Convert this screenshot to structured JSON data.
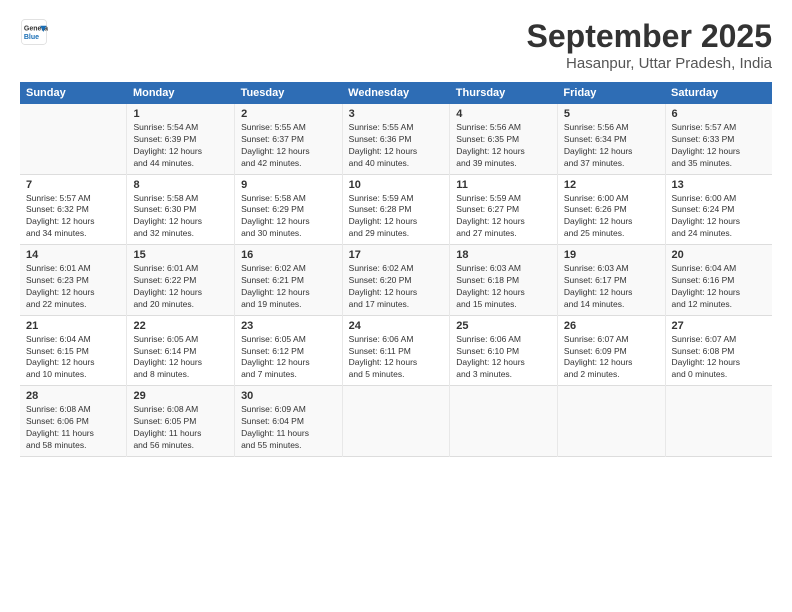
{
  "logo": {
    "line1": "General",
    "line2": "Blue"
  },
  "title": "September 2025",
  "subtitle": "Hasanpur, Uttar Pradesh, India",
  "days_header": [
    "Sunday",
    "Monday",
    "Tuesday",
    "Wednesday",
    "Thursday",
    "Friday",
    "Saturday"
  ],
  "weeks": [
    [
      {
        "num": "",
        "info": ""
      },
      {
        "num": "1",
        "info": "Sunrise: 5:54 AM\nSunset: 6:39 PM\nDaylight: 12 hours\nand 44 minutes."
      },
      {
        "num": "2",
        "info": "Sunrise: 5:55 AM\nSunset: 6:37 PM\nDaylight: 12 hours\nand 42 minutes."
      },
      {
        "num": "3",
        "info": "Sunrise: 5:55 AM\nSunset: 6:36 PM\nDaylight: 12 hours\nand 40 minutes."
      },
      {
        "num": "4",
        "info": "Sunrise: 5:56 AM\nSunset: 6:35 PM\nDaylight: 12 hours\nand 39 minutes."
      },
      {
        "num": "5",
        "info": "Sunrise: 5:56 AM\nSunset: 6:34 PM\nDaylight: 12 hours\nand 37 minutes."
      },
      {
        "num": "6",
        "info": "Sunrise: 5:57 AM\nSunset: 6:33 PM\nDaylight: 12 hours\nand 35 minutes."
      }
    ],
    [
      {
        "num": "7",
        "info": "Sunrise: 5:57 AM\nSunset: 6:32 PM\nDaylight: 12 hours\nand 34 minutes."
      },
      {
        "num": "8",
        "info": "Sunrise: 5:58 AM\nSunset: 6:30 PM\nDaylight: 12 hours\nand 32 minutes."
      },
      {
        "num": "9",
        "info": "Sunrise: 5:58 AM\nSunset: 6:29 PM\nDaylight: 12 hours\nand 30 minutes."
      },
      {
        "num": "10",
        "info": "Sunrise: 5:59 AM\nSunset: 6:28 PM\nDaylight: 12 hours\nand 29 minutes."
      },
      {
        "num": "11",
        "info": "Sunrise: 5:59 AM\nSunset: 6:27 PM\nDaylight: 12 hours\nand 27 minutes."
      },
      {
        "num": "12",
        "info": "Sunrise: 6:00 AM\nSunset: 6:26 PM\nDaylight: 12 hours\nand 25 minutes."
      },
      {
        "num": "13",
        "info": "Sunrise: 6:00 AM\nSunset: 6:24 PM\nDaylight: 12 hours\nand 24 minutes."
      }
    ],
    [
      {
        "num": "14",
        "info": "Sunrise: 6:01 AM\nSunset: 6:23 PM\nDaylight: 12 hours\nand 22 minutes."
      },
      {
        "num": "15",
        "info": "Sunrise: 6:01 AM\nSunset: 6:22 PM\nDaylight: 12 hours\nand 20 minutes."
      },
      {
        "num": "16",
        "info": "Sunrise: 6:02 AM\nSunset: 6:21 PM\nDaylight: 12 hours\nand 19 minutes."
      },
      {
        "num": "17",
        "info": "Sunrise: 6:02 AM\nSunset: 6:20 PM\nDaylight: 12 hours\nand 17 minutes."
      },
      {
        "num": "18",
        "info": "Sunrise: 6:03 AM\nSunset: 6:18 PM\nDaylight: 12 hours\nand 15 minutes."
      },
      {
        "num": "19",
        "info": "Sunrise: 6:03 AM\nSunset: 6:17 PM\nDaylight: 12 hours\nand 14 minutes."
      },
      {
        "num": "20",
        "info": "Sunrise: 6:04 AM\nSunset: 6:16 PM\nDaylight: 12 hours\nand 12 minutes."
      }
    ],
    [
      {
        "num": "21",
        "info": "Sunrise: 6:04 AM\nSunset: 6:15 PM\nDaylight: 12 hours\nand 10 minutes."
      },
      {
        "num": "22",
        "info": "Sunrise: 6:05 AM\nSunset: 6:14 PM\nDaylight: 12 hours\nand 8 minutes."
      },
      {
        "num": "23",
        "info": "Sunrise: 6:05 AM\nSunset: 6:12 PM\nDaylight: 12 hours\nand 7 minutes."
      },
      {
        "num": "24",
        "info": "Sunrise: 6:06 AM\nSunset: 6:11 PM\nDaylight: 12 hours\nand 5 minutes."
      },
      {
        "num": "25",
        "info": "Sunrise: 6:06 AM\nSunset: 6:10 PM\nDaylight: 12 hours\nand 3 minutes."
      },
      {
        "num": "26",
        "info": "Sunrise: 6:07 AM\nSunset: 6:09 PM\nDaylight: 12 hours\nand 2 minutes."
      },
      {
        "num": "27",
        "info": "Sunrise: 6:07 AM\nSunset: 6:08 PM\nDaylight: 12 hours\nand 0 minutes."
      }
    ],
    [
      {
        "num": "28",
        "info": "Sunrise: 6:08 AM\nSunset: 6:06 PM\nDaylight: 11 hours\nand 58 minutes."
      },
      {
        "num": "29",
        "info": "Sunrise: 6:08 AM\nSunset: 6:05 PM\nDaylight: 11 hours\nand 56 minutes."
      },
      {
        "num": "30",
        "info": "Sunrise: 6:09 AM\nSunset: 6:04 PM\nDaylight: 11 hours\nand 55 minutes."
      },
      {
        "num": "",
        "info": ""
      },
      {
        "num": "",
        "info": ""
      },
      {
        "num": "",
        "info": ""
      },
      {
        "num": "",
        "info": ""
      }
    ]
  ]
}
